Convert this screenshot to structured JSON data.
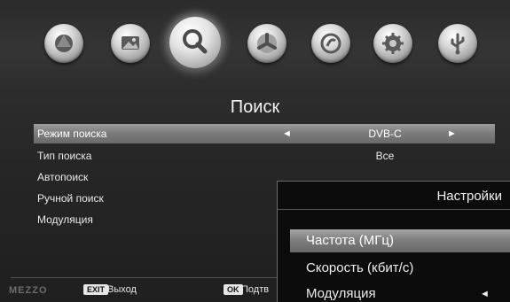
{
  "nav_icons": [
    {
      "name": "channels-icon"
    },
    {
      "name": "picture-icon"
    },
    {
      "name": "search-icon",
      "active": true
    },
    {
      "name": "time-icon"
    },
    {
      "name": "options-icon"
    },
    {
      "name": "settings-icon"
    },
    {
      "name": "usb-icon"
    }
  ],
  "page_title": "Поиск",
  "menu": {
    "items": [
      {
        "label": "Режим поиска",
        "value": "DVB-C",
        "selected": true
      },
      {
        "label": "Тип поиска",
        "value": "Все"
      },
      {
        "label": "Автопоиск",
        "value": ""
      },
      {
        "label": "Ручной поиск",
        "value": ""
      },
      {
        "label": "Модуляция",
        "value": ""
      }
    ],
    "arrow_left": "◄",
    "arrow_right": "►"
  },
  "footer": {
    "logo": "MEZZO",
    "exit_key": "EXIT",
    "exit_label": "Выход",
    "ok_key": "OK",
    "ok_label": "Подтв"
  },
  "panel": {
    "title": "Настройки",
    "items": [
      {
        "label": "Частота (МГц)",
        "selected": true
      },
      {
        "label": "Скорость (кбит/с)"
      },
      {
        "label": "Модуляция"
      }
    ],
    "arrow": "◄"
  },
  "colors": {
    "background": "#2f2f2f",
    "highlight": "#8a8a8a",
    "panel_bg": "#0c0c0c",
    "text": "#eaeaea"
  }
}
